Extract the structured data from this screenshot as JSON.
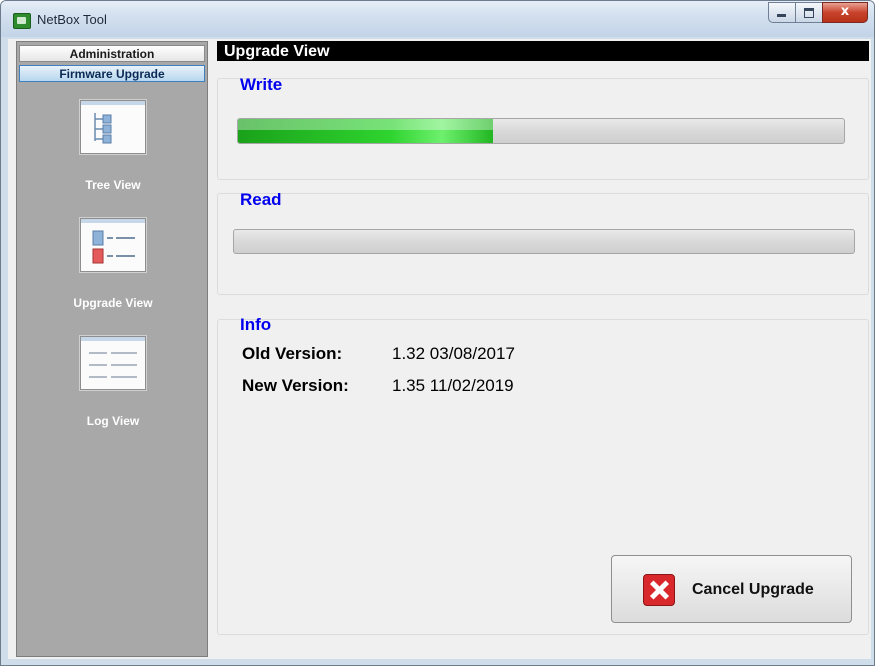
{
  "window": {
    "title": "NetBox Tool",
    "icons": {
      "app": "netbox-app-icon",
      "minimize": "minimize-icon",
      "maximize": "maximize-icon",
      "close": "close-icon"
    },
    "close_glyph": "x"
  },
  "sidebar": {
    "administration_label": "Administration",
    "firmware_upgrade_label": "Firmware Upgrade",
    "tools": [
      {
        "label": "Tree View",
        "icon": "tree-view-icon"
      },
      {
        "label": "Upgrade View",
        "icon": "upgrade-view-icon"
      },
      {
        "label": "Log View",
        "icon": "log-view-icon"
      }
    ]
  },
  "main": {
    "header": "Upgrade View",
    "write": {
      "title": "Write",
      "progress": 0.42
    },
    "read": {
      "title": "Read",
      "progress": 0
    },
    "info": {
      "title": "Info",
      "old_label": "Old Version:",
      "old_value": "1.32 03/08/2017",
      "new_label": "New Version:",
      "new_value": "1.35 11/02/2019"
    },
    "cancel_label": "Cancel Upgrade",
    "cancel_icon": "cancel-x-icon"
  },
  "colors": {
    "section_title": "#0000ee",
    "progress_fill": "#2fd42f",
    "header_bg": "#000000",
    "sidebar_bg": "#a8a8a8",
    "cancel_icon": "#d8282c"
  }
}
